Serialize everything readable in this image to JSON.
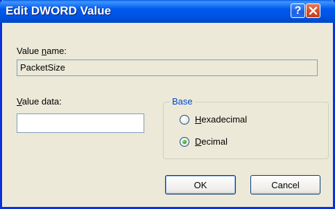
{
  "window": {
    "title": "Edit DWORD Value"
  },
  "titlebar": {
    "help_glyph": "?",
    "close_icon": "close-icon"
  },
  "value_name": {
    "label_prefix": "Value ",
    "label_accel": "n",
    "label_suffix": "ame:",
    "value": "PacketSize"
  },
  "value_data": {
    "label_accel": "V",
    "label_suffix": "alue data:",
    "value": ""
  },
  "base": {
    "legend": "Base",
    "options": [
      {
        "accel": "H",
        "rest": "exadecimal",
        "selected": false
      },
      {
        "accel": "D",
        "rest": "ecimal",
        "selected": true
      }
    ]
  },
  "buttons": {
    "ok": "OK",
    "cancel": "Cancel"
  }
}
